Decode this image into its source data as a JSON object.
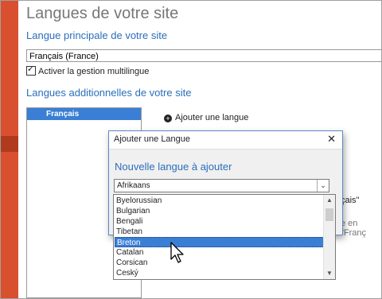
{
  "page": {
    "title": "Langues de votre site",
    "primary_heading": "Langue principale de votre site",
    "primary_language_value": "Français (France)",
    "multilingual_label": "Activer la gestion multilingue",
    "multilingual_checked": true,
    "additional_heading": "Langues additionnelles de votre site",
    "additional_languages": [
      "Français"
    ],
    "add_language_label": "Ajouter une langue",
    "partial_text_1": "çais\"",
    "partial_text_2": "e en \"Franç"
  },
  "dialog": {
    "title": "Ajouter une Langue",
    "close_glyph": "✕",
    "heading": "Nouvelle langue à ajouter",
    "combo_value": "Afrikaans",
    "combo_arrow": "⌄"
  },
  "dropdown": {
    "items": [
      "Byelorussian",
      "Bulgarian",
      "Bengali",
      "Tibetan",
      "Breton",
      "Catalan",
      "Corsican",
      "Ceský"
    ],
    "selected": "Breton",
    "scroll_up": "▲",
    "scroll_down": "▼"
  },
  "colors": {
    "accent_red": "#d9502e",
    "heading_blue": "#2a6ebb",
    "selection_blue": "#3a7fd5"
  },
  "icons": [
    "add-icon",
    "close-icon",
    "chevron-down-icon",
    "cursor-icon"
  ]
}
